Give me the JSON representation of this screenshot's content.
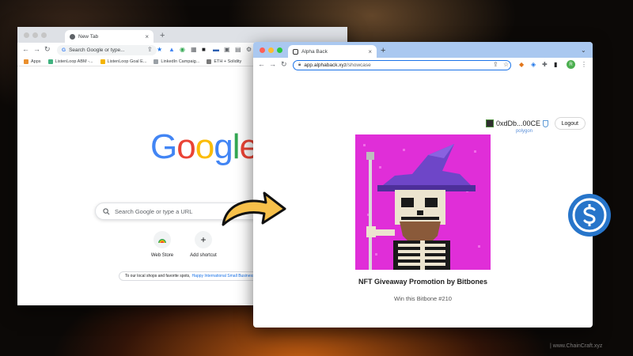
{
  "colors": {
    "google_blue": "#4285F4",
    "google_red": "#EA4335",
    "google_yellow": "#FBBC05",
    "google_green": "#34A853",
    "nft_background": "#E02ED8",
    "wizard_hat": "#6E46C8",
    "usdc_blue": "#2775CA",
    "right_tabstrip": "#AAC8F0",
    "left_tabstrip": "#DEE1E6"
  },
  "left_window": {
    "tab_title": "New Tab",
    "omnibox_placeholder": "Search Google or type...",
    "bookmarks": [
      {
        "label": "Apps",
        "icon": "apps-grid-icon"
      },
      {
        "label": "ListenLoop ABM -...",
        "icon": "bookmark-favicon"
      },
      {
        "label": "ListenLoop Goal E...",
        "icon": "chart-favicon"
      },
      {
        "label": "LinkedIn Campaig...",
        "icon": "bookmark-favicon"
      },
      {
        "label": "ETH + Solidity",
        "icon": "folder-icon"
      }
    ],
    "logo_letters": [
      "G",
      "o",
      "o",
      "g",
      "l",
      "e"
    ],
    "search_placeholder": "Search Google or type a URL",
    "shortcuts": [
      {
        "label": "Web Store",
        "icon": "web-store-icon"
      },
      {
        "label": "Add shortcut",
        "icon": "plus-icon"
      }
    ],
    "notice_text": "To our local shops and favorite spots,",
    "notice_link": "Happy International Small Business W..."
  },
  "right_window": {
    "tab_title": "Alpha Back",
    "url_domain": "app.alphaback.xyz",
    "url_path": "/showcase",
    "wallet_address": "0xdDb...00CE",
    "network": "polygon",
    "logout_label": "Logout",
    "nft_title": "NFT Giveaway Promotion by Bitbones",
    "nft_subtitle": "Win this Bitbone #210"
  },
  "watermark": "| www.ChainCraft.xyz"
}
